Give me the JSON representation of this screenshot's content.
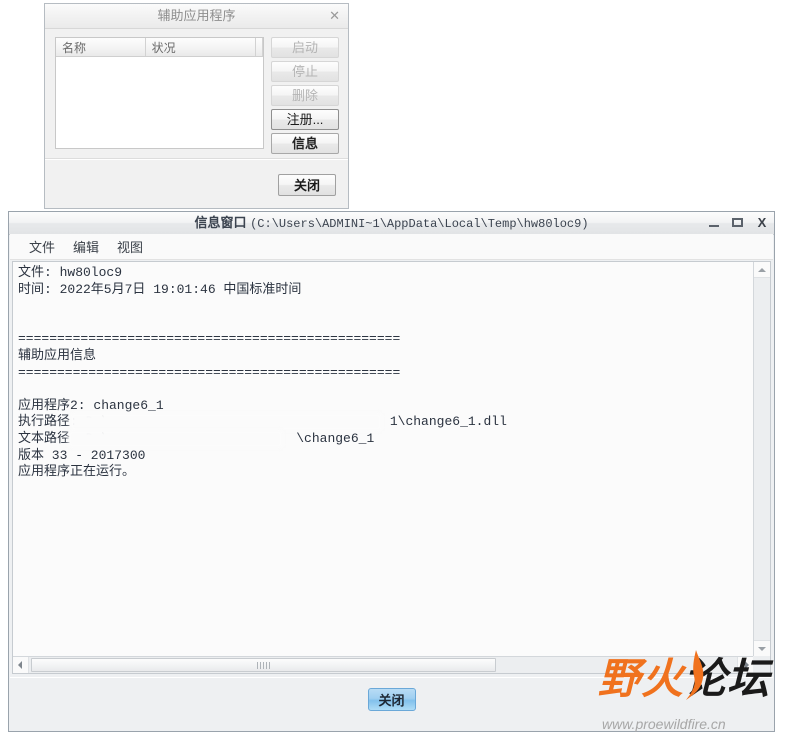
{
  "aux_dialog": {
    "title": "辅助应用程序",
    "close_icon": "close-x-icon",
    "list": {
      "columns": [
        "名称",
        "状况"
      ],
      "rows": []
    },
    "buttons": [
      {
        "label": "启动",
        "state": "disabled"
      },
      {
        "label": "停止",
        "state": "disabled"
      },
      {
        "label": "删除",
        "state": "disabled"
      },
      {
        "label": "注册...",
        "state": "enabled"
      },
      {
        "label": "信息",
        "state": "enabled-focused"
      }
    ],
    "close_button": "关闭"
  },
  "info_window": {
    "title_main": "信息窗口",
    "title_path": "(C:\\Users\\ADMINI~1\\AppData\\Local\\Temp\\hw80loc9)",
    "window_controls": {
      "minimize": "minimize-icon",
      "maximize": "maximize-icon",
      "close": "X"
    },
    "menu": [
      "文件",
      "编辑",
      "视图"
    ],
    "content_lines": [
      "文件: hw80loc9",
      "时间: 2022年5月7日 19:01:46 中国标准时间",
      "",
      "",
      "=================================================",
      "辅助应用信息",
      "=================================================",
      "",
      "应用程序2: change6_1",
      "执行路径: D:\\                                    1\\change6_1.dll",
      "文本路径: D:\\                        \\change6_1",
      "版本 33 - 2017300",
      "应用程序正在运行。"
    ],
    "scrollbars": {
      "vertical_up": "scroll-up-arrow-icon",
      "vertical_down": "scroll-down-arrow-icon",
      "horizontal_left": "scroll-left-arrow-icon",
      "horizontal_right": "scroll-right-arrow-icon"
    },
    "close_button": "关闭"
  },
  "watermark": {
    "char1": "野",
    "char2": "火",
    "chars_rest": "论坛",
    "url": "www.proewildfire.cn",
    "accent_color": "#f0721e"
  }
}
